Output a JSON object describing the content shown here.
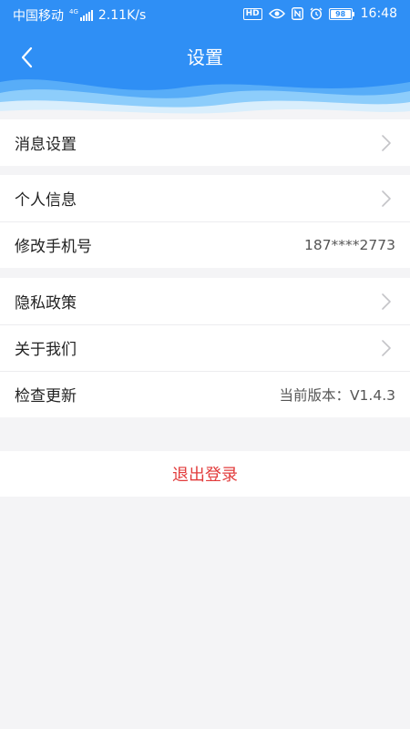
{
  "status_bar": {
    "carrier": "中国移动",
    "network_gen": "4G",
    "speed": "2.11K/s",
    "hd_badge": "HD",
    "battery": "98",
    "time": "16:48"
  },
  "header": {
    "title": "设置",
    "back_icon": "chevron-left-icon",
    "bg_color": "#2f8ff5"
  },
  "sections": [
    {
      "items": [
        {
          "label": "消息设置",
          "value": "",
          "icon": "chevron-right-icon"
        }
      ]
    },
    {
      "items": [
        {
          "label": "个人信息",
          "value": "",
          "icon": "chevron-right-icon"
        },
        {
          "label": "修改手机号",
          "value": "187****2773"
        }
      ]
    },
    {
      "items": [
        {
          "label": "隐私政策",
          "value": "",
          "icon": "chevron-right-icon"
        },
        {
          "label": "关于我们",
          "value": "",
          "icon": "chevron-right-icon"
        },
        {
          "label": "检查更新",
          "value": "当前版本：V1.4.3"
        }
      ]
    }
  ],
  "logout": {
    "label": "退出登录",
    "color": "#e23c3c"
  }
}
